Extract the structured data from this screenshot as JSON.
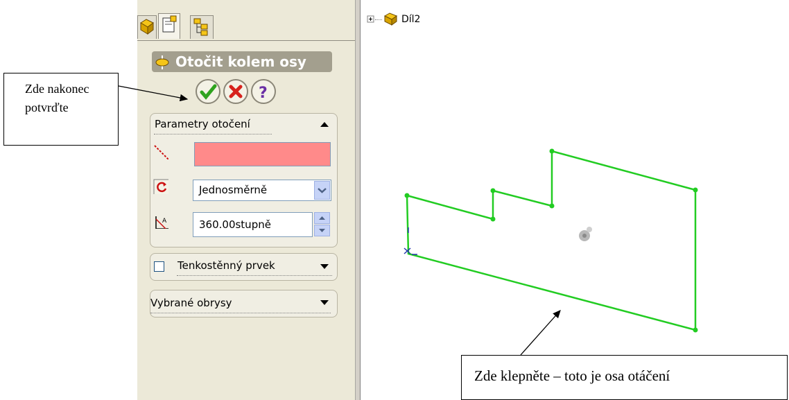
{
  "panel": {
    "title": "Otočit kolem osy",
    "buttons": {
      "ok_icon": "green-checkmark-icon",
      "cancel_icon": "red-x-icon",
      "help_icon": "question-mark-icon"
    },
    "params_group": {
      "header": "Parametry otočení",
      "direction_value": "Jednosměrně",
      "angle_value": "360.00stupně"
    },
    "thin_group": {
      "header": "Tenkostěnný prvek",
      "checked": false
    },
    "contours_group": {
      "header": "Vybrané obrysy"
    }
  },
  "tree": {
    "part_label": "Díl2"
  },
  "callouts": {
    "left_text": "Zde nakonec potvrďte",
    "bottom_text": "Zde klepněte – toto je osa otáčení"
  },
  "colors": {
    "sketch": "#22cc22",
    "axis_field_error": "#ff8a8a",
    "title_bar": "#a39f8e"
  }
}
